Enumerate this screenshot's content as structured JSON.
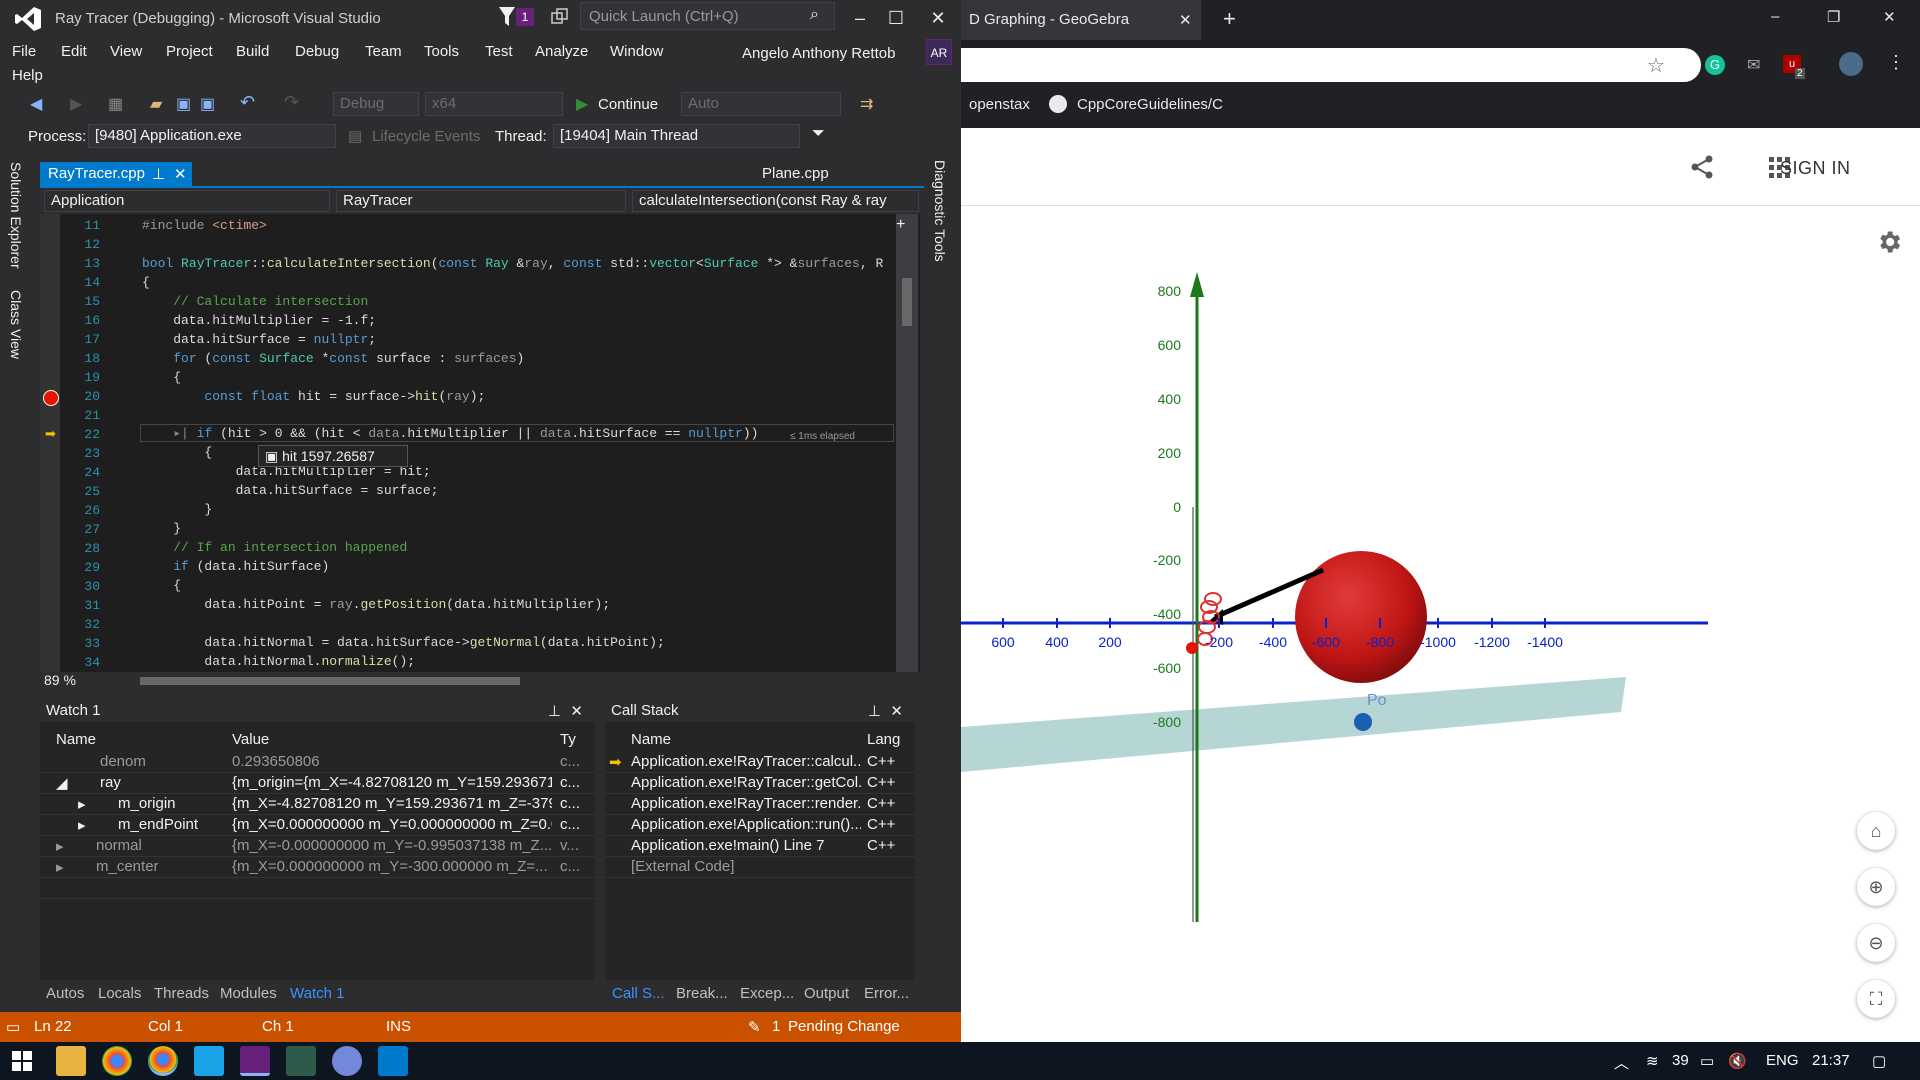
{
  "vs": {
    "title": "Ray Tracer (Debugging) - Microsoft Visual Studio",
    "notification_count": "1",
    "quick_launch_placeholder": "Quick Launch (Ctrl+Q)",
    "menu": [
      "File",
      "Edit",
      "View",
      "Project",
      "Build",
      "Debug",
      "Team",
      "Tools",
      "Test",
      "Analyze",
      "Window",
      "Help"
    ],
    "user_name": "Angelo Anthony Rettob",
    "user_initials": "AR",
    "toolbar": {
      "config": "Debug",
      "platform": "x64",
      "continue": "Continue",
      "auto": "Auto"
    },
    "process_label": "Process:",
    "process_value": "[9480] Application.exe",
    "lifecycle": "Lifecycle Events",
    "thread_label": "Thread:",
    "thread_value": "[19404] Main Thread",
    "left_strip": [
      "Solution Explorer",
      "Class View"
    ],
    "right_strip": "Diagnostic Tools",
    "tabs": {
      "active": "RayTracer.cpp",
      "other": "Plane.cpp"
    },
    "nav": {
      "project": "Application",
      "class": "RayTracer",
      "member": "calculateIntersection(const Ray & ray"
    },
    "datatip": "hit 1597.26587",
    "elapsed": "≤ 1ms elapsed",
    "zoom": "89 %",
    "line_numbers": [
      "11",
      "12",
      "13",
      "14",
      "15",
      "16",
      "17",
      "18",
      "19",
      "20",
      "21",
      "22",
      "23",
      "24",
      "25",
      "26",
      "27",
      "28",
      "29",
      "30",
      "31",
      "32",
      "33",
      "34"
    ],
    "watch": {
      "title": "Watch 1",
      "columns": [
        "Name",
        "Value",
        "Ty"
      ],
      "rows": [
        {
          "name": "denom",
          "value": "0.293650806",
          "type": "c..."
        },
        {
          "name": "ray",
          "value": "{m_origin={m_X=-4.82708120 m_Y=159.293671...",
          "type": "c..."
        },
        {
          "name": "m_origin",
          "value": "{m_X=-4.82708120 m_Y=159.293671 m_Z=-379....",
          "type": "c..."
        },
        {
          "name": "m_endPoint",
          "value": "{m_X=0.000000000 m_Y=0.000000000 m_Z=0.0...",
          "type": "c..."
        },
        {
          "name": "normal",
          "value": "{m_X=-0.000000000 m_Y=-0.995037138 m_Z...",
          "type": "v..."
        },
        {
          "name": "m_center",
          "value": "{m_X=0.000000000 m_Y=-300.000000 m_Z=...",
          "type": "c..."
        }
      ],
      "bottom_tabs": [
        "Autos",
        "Locals",
        "Threads",
        "Modules",
        "Watch 1"
      ]
    },
    "callstack": {
      "title": "Call Stack",
      "columns": [
        "Name",
        "Lang"
      ],
      "rows": [
        {
          "name": "Application.exe!RayTracer::calcul...",
          "lang": "C++"
        },
        {
          "name": "Application.exe!RayTracer::getCol...",
          "lang": "C++"
        },
        {
          "name": "Application.exe!RayTracer::render...",
          "lang": "C++"
        },
        {
          "name": "Application.exe!Application::run()...",
          "lang": "C++"
        },
        {
          "name": "Application.exe!main() Line 7",
          "lang": "C++"
        },
        {
          "name": "[External Code]",
          "lang": ""
        }
      ],
      "bottom_tabs": [
        "Call S...",
        "Break...",
        "Excep...",
        "Output",
        "Error..."
      ]
    },
    "status": {
      "ln": "Ln 22",
      "col": "Col 1",
      "ch": "Ch 1",
      "ins": "INS",
      "pending_count": "1",
      "pending": "Pending Change"
    }
  },
  "browser": {
    "tab_title": "D Graphing - GeoGebra",
    "bookmarks": [
      "openstax",
      "CppCoreGuidelines/C"
    ],
    "ext_badge": "2",
    "sign_in": "SIGN IN",
    "graph": {
      "x_ticks": [
        "600",
        "400",
        "200",
        "-200",
        "-400",
        "-600",
        "-800",
        "-1000",
        "-1200",
        "-1400"
      ],
      "y_ticks": [
        "800",
        "600",
        "400",
        "200",
        "0",
        "-200",
        "-400",
        "-600",
        "-800"
      ],
      "point_label": "Po"
    }
  },
  "taskbar": {
    "temp": "39",
    "lang": "ENG",
    "time": "21:37"
  },
  "colors": {
    "vs_accent": "#007acc",
    "status": "#ca5100",
    "vs_purple": "#68217a",
    "sphere": "#cc1a1a",
    "axis_blue": "#0a22c8",
    "axis_green": "#1a7a1a"
  }
}
